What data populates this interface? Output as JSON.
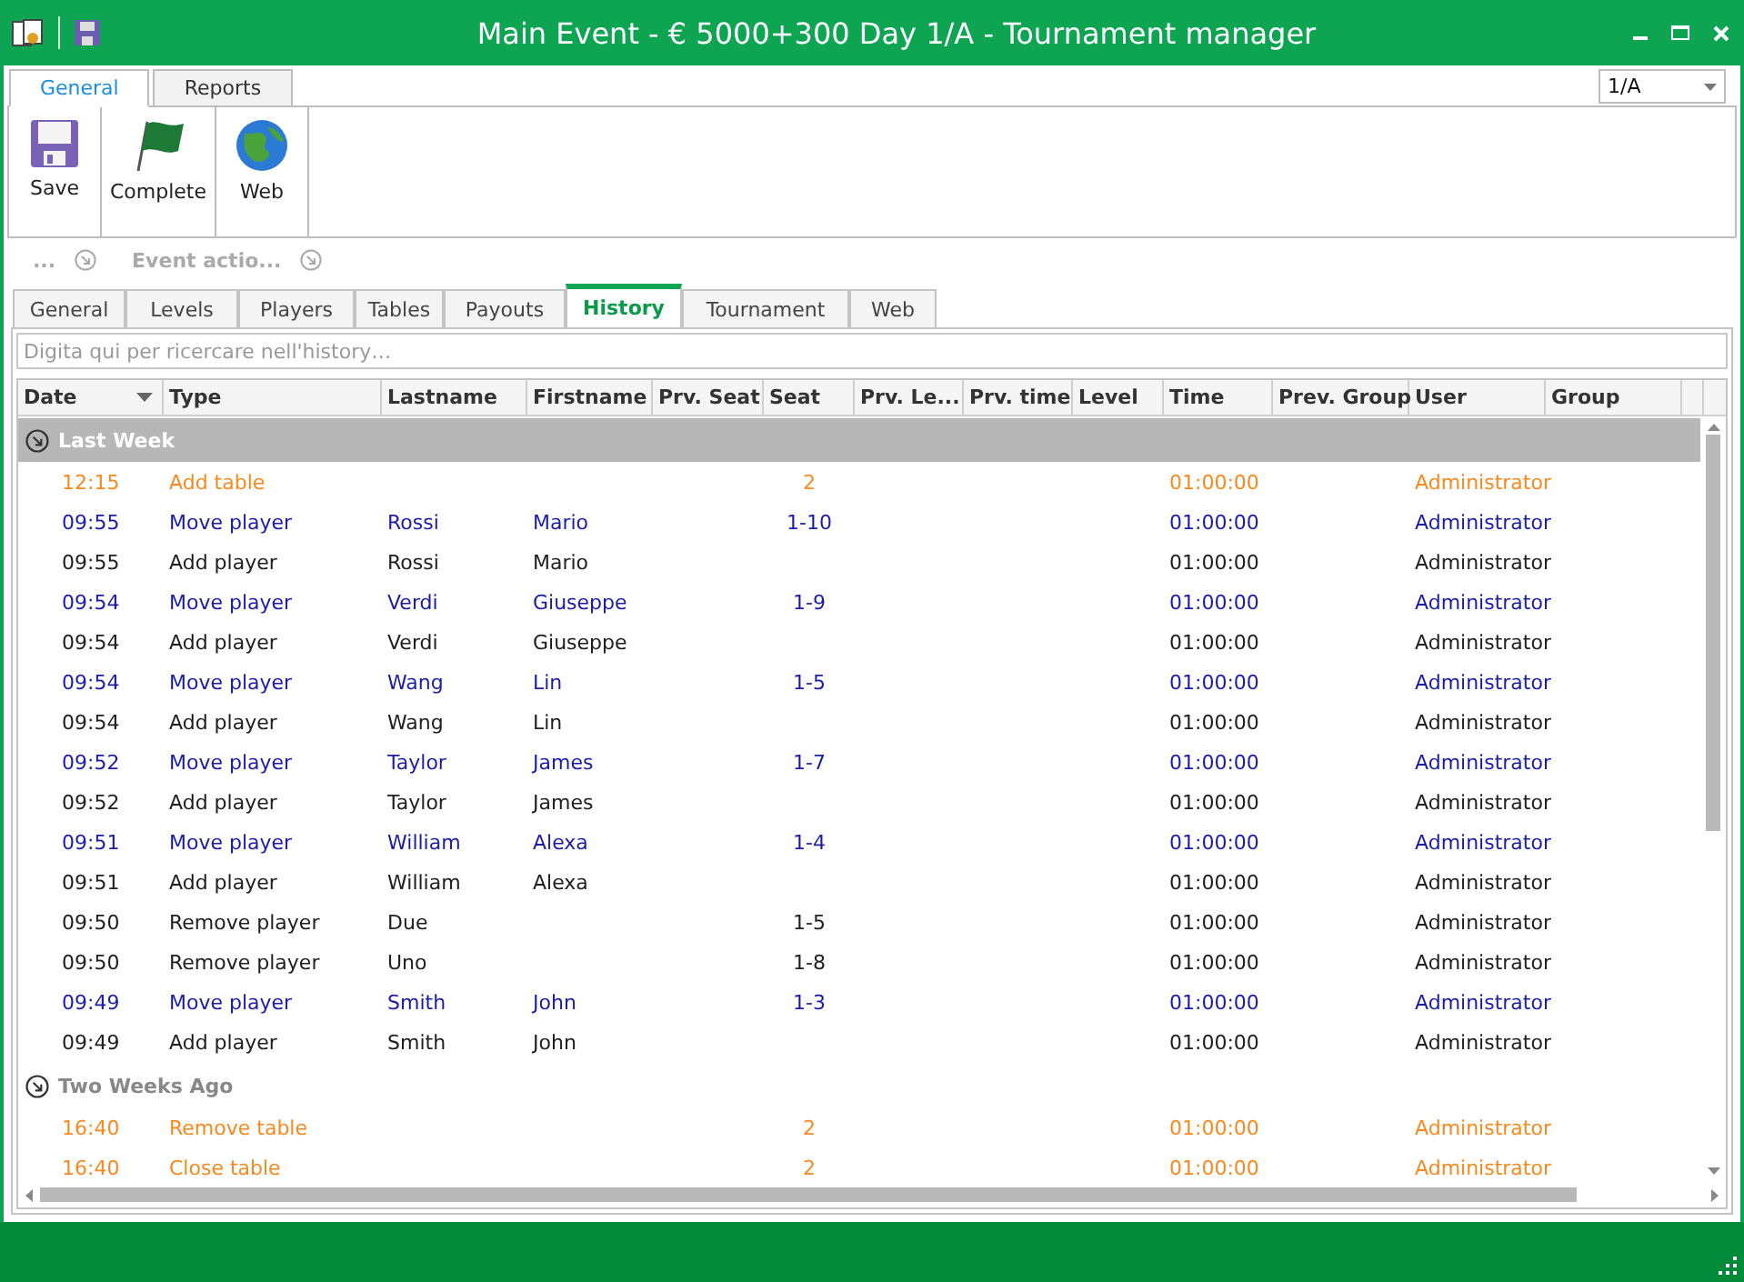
{
  "window": {
    "title": "Main Event - € 5000+300 Day 1/A - Tournament manager"
  },
  "ribbon_tabs": [
    {
      "label": "General",
      "selected": true
    },
    {
      "label": "Reports",
      "selected": false
    }
  ],
  "day_select": {
    "value": "1/A"
  },
  "ribbon_buttons": [
    {
      "label": "Save",
      "kind": "save"
    },
    {
      "label": "Complete",
      "kind": "flag"
    },
    {
      "label": "Web",
      "kind": "globe"
    }
  ],
  "ribbon_groups": [
    {
      "label": "..."
    },
    {
      "label": "Event actio..."
    }
  ],
  "tabs": [
    {
      "label": "General",
      "selected": false
    },
    {
      "label": "Levels",
      "selected": false
    },
    {
      "label": "Players",
      "selected": false
    },
    {
      "label": "Tables",
      "selected": false
    },
    {
      "label": "Payouts",
      "selected": false
    },
    {
      "label": "History",
      "selected": true
    },
    {
      "label": "Tournament",
      "selected": false
    },
    {
      "label": "Web",
      "selected": false
    }
  ],
  "search": {
    "placeholder": "Digita qui per ricercare nell'history…"
  },
  "table": {
    "columns": [
      "Date",
      "Type",
      "Lastname",
      "Firstname",
      "Prv. Seat",
      "Seat",
      "Prv. Le...",
      "Prv. time",
      "Level",
      "Time",
      "Prev. Group",
      "User",
      "Group"
    ],
    "groups": [
      {
        "label": "Last Week",
        "selected": true,
        "expanded": true,
        "rows": [
          {
            "date": "12:15",
            "type": "Add table",
            "seat": "2",
            "time": "01:00:00",
            "user": "Administrator",
            "color": "#f7891e"
          },
          {
            "date": "09:55",
            "type": "Move player",
            "lastname": "Rossi",
            "firstname": "Mario",
            "seat": "1-10",
            "time": "01:00:00",
            "user": "Administrator",
            "color": "#1c1ca8"
          },
          {
            "date": "09:55",
            "type": "Add player",
            "lastname": "Rossi",
            "firstname": "Mario",
            "time": "01:00:00",
            "user": "Administrator",
            "color": "#202020"
          },
          {
            "date": "09:54",
            "type": "Move player",
            "lastname": "Verdi",
            "firstname": "Giuseppe",
            "seat": "1-9",
            "time": "01:00:00",
            "user": "Administrator",
            "color": "#1c1ca8"
          },
          {
            "date": "09:54",
            "type": "Add player",
            "lastname": "Verdi",
            "firstname": "Giuseppe",
            "time": "01:00:00",
            "user": "Administrator",
            "color": "#202020"
          },
          {
            "date": "09:54",
            "type": "Move player",
            "lastname": "Wang",
            "firstname": "Lin",
            "seat": "1-5",
            "time": "01:00:00",
            "user": "Administrator",
            "color": "#1c1ca8"
          },
          {
            "date": "09:54",
            "type": "Add player",
            "lastname": "Wang",
            "firstname": "Lin",
            "time": "01:00:00",
            "user": "Administrator",
            "color": "#202020"
          },
          {
            "date": "09:52",
            "type": "Move player",
            "lastname": "Taylor",
            "firstname": "James",
            "seat": "1-7",
            "time": "01:00:00",
            "user": "Administrator",
            "color": "#1c1ca8"
          },
          {
            "date": "09:52",
            "type": "Add player",
            "lastname": "Taylor",
            "firstname": "James",
            "time": "01:00:00",
            "user": "Administrator",
            "color": "#202020"
          },
          {
            "date": "09:51",
            "type": "Move player",
            "lastname": "William",
            "firstname": "Alexa",
            "seat": "1-4",
            "time": "01:00:00",
            "user": "Administrator",
            "color": "#1c1ca8"
          },
          {
            "date": "09:51",
            "type": "Add player",
            "lastname": "William",
            "firstname": "Alexa",
            "time": "01:00:00",
            "user": "Administrator",
            "color": "#202020"
          },
          {
            "date": "09:50",
            "type": "Remove player",
            "lastname": "Due",
            "seat": "1-5",
            "time": "01:00:00",
            "user": "Administrator",
            "color": "#202020"
          },
          {
            "date": "09:50",
            "type": "Remove player",
            "lastname": "Uno",
            "seat": "1-8",
            "time": "01:00:00",
            "user": "Administrator",
            "color": "#202020"
          },
          {
            "date": "09:49",
            "type": "Move player",
            "lastname": "Smith",
            "firstname": "John",
            "seat": "1-3",
            "time": "01:00:00",
            "user": "Administrator",
            "color": "#1c1ca8"
          },
          {
            "date": "09:49",
            "type": "Add player",
            "lastname": "Smith",
            "firstname": "John",
            "time": "01:00:00",
            "user": "Administrator",
            "color": "#202020"
          }
        ]
      },
      {
        "label": "Two Weeks Ago",
        "selected": false,
        "expanded": true,
        "rows": [
          {
            "date": "16:40",
            "type": "Remove table",
            "seat": "2",
            "time": "01:00:00",
            "user": "Administrator",
            "color": "#f7891e"
          },
          {
            "date": "16:40",
            "type": "Close table",
            "seat": "2",
            "time": "01:00:00",
            "user": "Administrator",
            "color": "#f7891e"
          }
        ]
      }
    ]
  }
}
